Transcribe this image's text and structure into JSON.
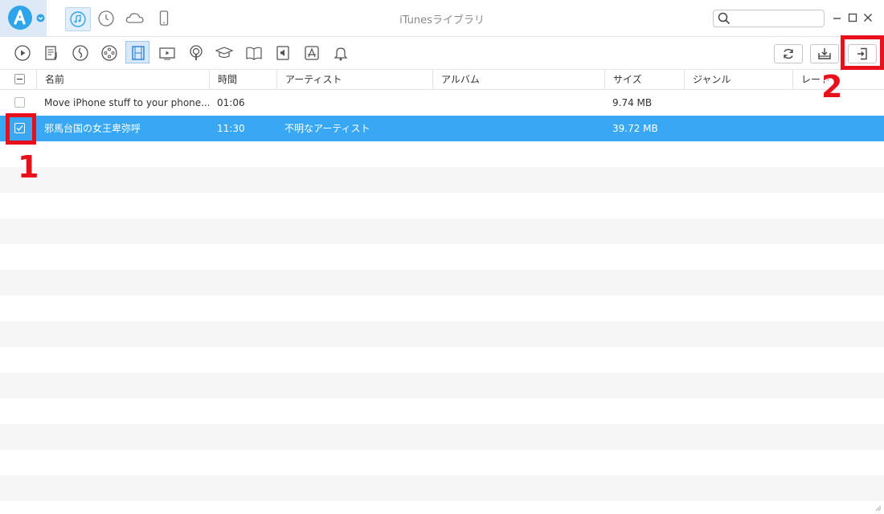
{
  "window": {
    "title": "iTunesライブラリ",
    "search_placeholder": ""
  },
  "modes": [
    "music-note-icon",
    "history-icon",
    "cloud-icon",
    "phone-icon"
  ],
  "toolbar": {
    "categories": [
      "play-circle-icon",
      "playlist-icon",
      "audiobook-icon",
      "music-folder-icon",
      "movies-icon",
      "tv-icon",
      "podcast-icon",
      "itunes-u-icon",
      "books-icon",
      "ringtone-icon",
      "app-store-icon",
      "bell-icon"
    ],
    "active_category": "movies-icon",
    "actions": [
      "refresh-icon",
      "export-to-pc-icon",
      "send-to-device-icon"
    ]
  },
  "table": {
    "columns": [
      "名前",
      "時間",
      "アーティスト",
      "アルバム",
      "サイズ",
      "ジャンル",
      "レート"
    ],
    "rows": [
      {
        "name": "Move iPhone stuff to your phone...",
        "time": "01:06",
        "artist": "",
        "album": "",
        "size": "9.74 MB",
        "genre": "",
        "rate": "",
        "checked": false
      },
      {
        "name": "邪馬台国の女王卑弥呼",
        "time": "11:30",
        "artist": "不明なアーティスト",
        "album": "",
        "size": "39.72 MB",
        "genre": "",
        "rate": "",
        "checked": true
      }
    ]
  },
  "annotations": {
    "step1": "1",
    "step2": "2"
  },
  "colors": {
    "accent": "#2ea4ea",
    "selection": "#38a8f5",
    "highlight": "#e8101a"
  }
}
